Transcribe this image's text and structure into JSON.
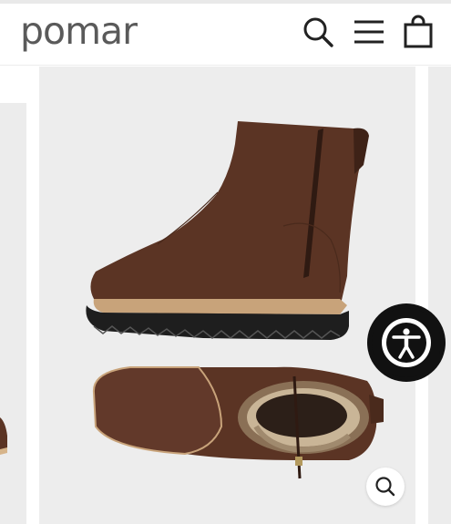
{
  "header": {
    "logo_text": "pomar",
    "icons": {
      "search": "search-icon",
      "menu": "menu-icon",
      "cart": "cart-icon"
    }
  },
  "gallery": {
    "main_image": "brown-boot-product-image",
    "accessibility_icon": "accessibility-icon",
    "zoom_icon": "zoom-icon"
  },
  "colors": {
    "logo": "#5a5a5a",
    "image_background": "#ededed",
    "boot_brown": "#5b3424",
    "accessibility_button": "#111111"
  }
}
